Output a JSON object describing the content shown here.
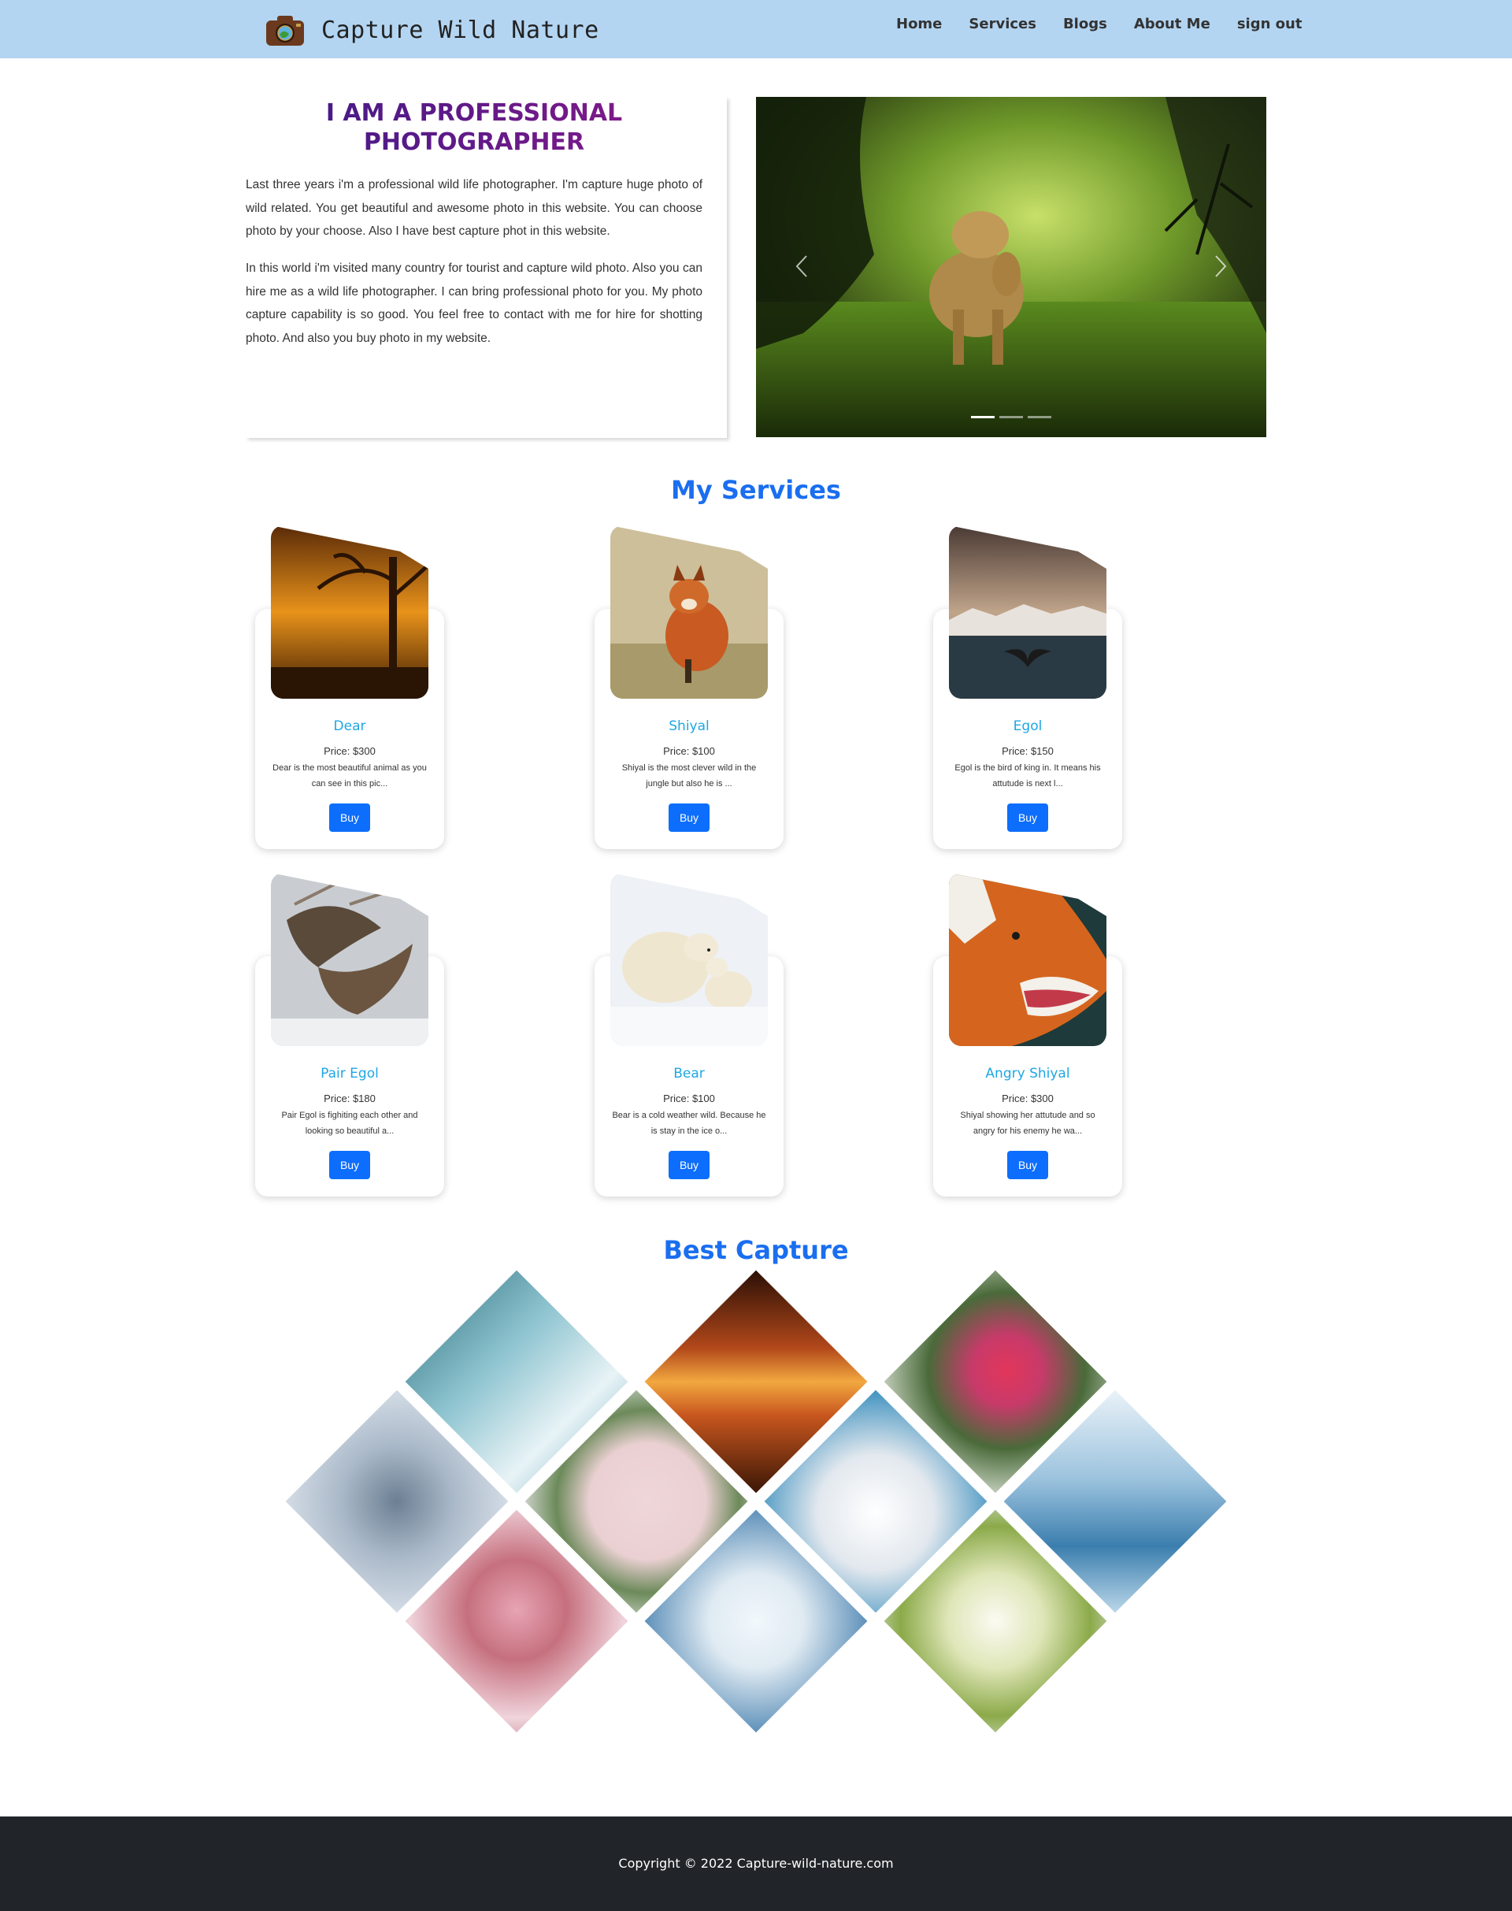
{
  "navbar": {
    "brand_title": "Capture Wild Nature",
    "links": [
      "Home",
      "Services",
      "Blogs",
      "About Me",
      "sign out"
    ]
  },
  "hero": {
    "heading": "I AM A PROFESSIONAL PHOTOGRAPHER",
    "paragraph_1": "Last three years i'm a professional wild life photographer. I'm capture huge photo of wild related. You get beautiful and awesome photo in this website. You can choose photo by your choose. Also I have best capture phot in this website.",
    "paragraph_2": "In this world i'm visited many country for tourist and capture wild photo. Also you can hire me as a wild life photographer. I can bring professional photo for you. My photo capture capability is so good. You feel free to contact with me for hire for shotting photo. And also you buy photo in my website.",
    "carousel_active_index": 0,
    "carousel_slide_count": 3
  },
  "services": {
    "title": "My Services",
    "buy_label": "Buy",
    "items": [
      {
        "name": "Dear",
        "price": "Price: $300",
        "desc": "Dear is the most beautiful animal as you can see in this pic..."
      },
      {
        "name": "Shiyal",
        "price": "Price: $100",
        "desc": "Shiyal is the most clever wild in the jungle but also he is ..."
      },
      {
        "name": "Egol",
        "price": "Price: $150",
        "desc": "Egol is the bird of king in. It means his attutude is next l..."
      },
      {
        "name": "Pair Egol",
        "price": "Price: $180",
        "desc": "Pair Egol is fighiting each other and looking so beautiful a..."
      },
      {
        "name": "Bear",
        "price": "Price: $100",
        "desc": "Bear is a cold weather wild. Because he is stay in the ice o..."
      },
      {
        "name": "Angry Shiyal",
        "price": "Price: $300",
        "desc": "Shiyal showing her attutude and so angry for his enemy he wa..."
      }
    ]
  },
  "gallery": {
    "title": "Best Capture"
  },
  "footer": {
    "copyright": "Copyright © 2022 Capture-wild-nature.com"
  }
}
